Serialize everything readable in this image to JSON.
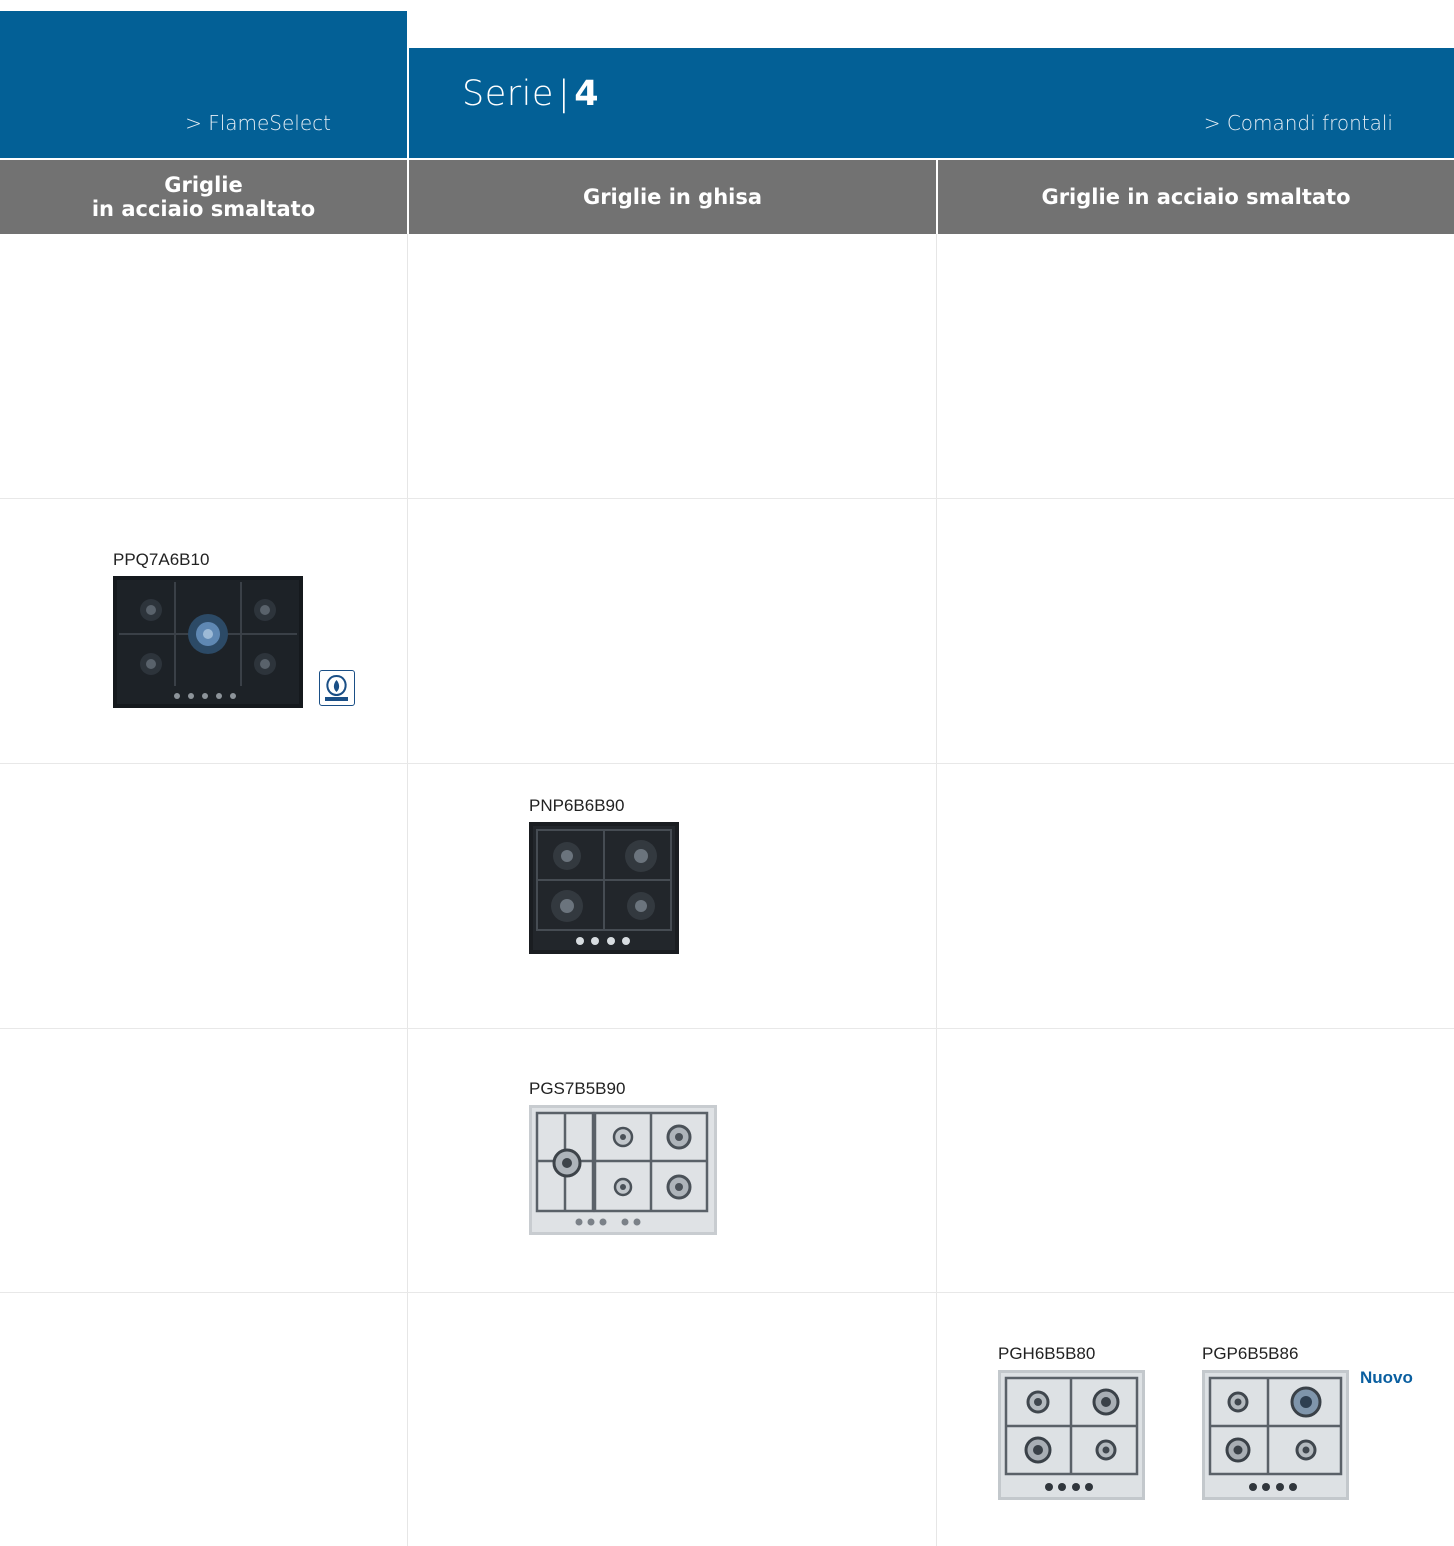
{
  "header": {
    "left_subtitle": "> FlameSelect",
    "serie_word": "Serie",
    "serie_separator": "|",
    "serie_number": "4",
    "right_subtitle": "> Comandi frontali"
  },
  "columns": [
    {
      "label": "Griglie\nin acciaio smaltato"
    },
    {
      "label": "Griglie in ghisa"
    },
    {
      "label": "Griglie in acciaio smaltato"
    }
  ],
  "products": [
    {
      "code": "PPQ7A6B10",
      "type": "dark-5-burner",
      "badge_icon": "flameselect-icon"
    },
    {
      "code": "PNP6B6B90",
      "type": "dark-4-burner"
    },
    {
      "code": "PGS7B5B90",
      "type": "steel-5-burner"
    },
    {
      "code": "PGH6B5B80",
      "type": "steel-4-burner"
    },
    {
      "code": "PGP6B5B86",
      "type": "steel-4-burner",
      "tag": "Nuovo"
    }
  ],
  "colors": {
    "brand_blue": "#036096",
    "header_grey": "#727272",
    "new_tag": "#0a5fa0"
  }
}
